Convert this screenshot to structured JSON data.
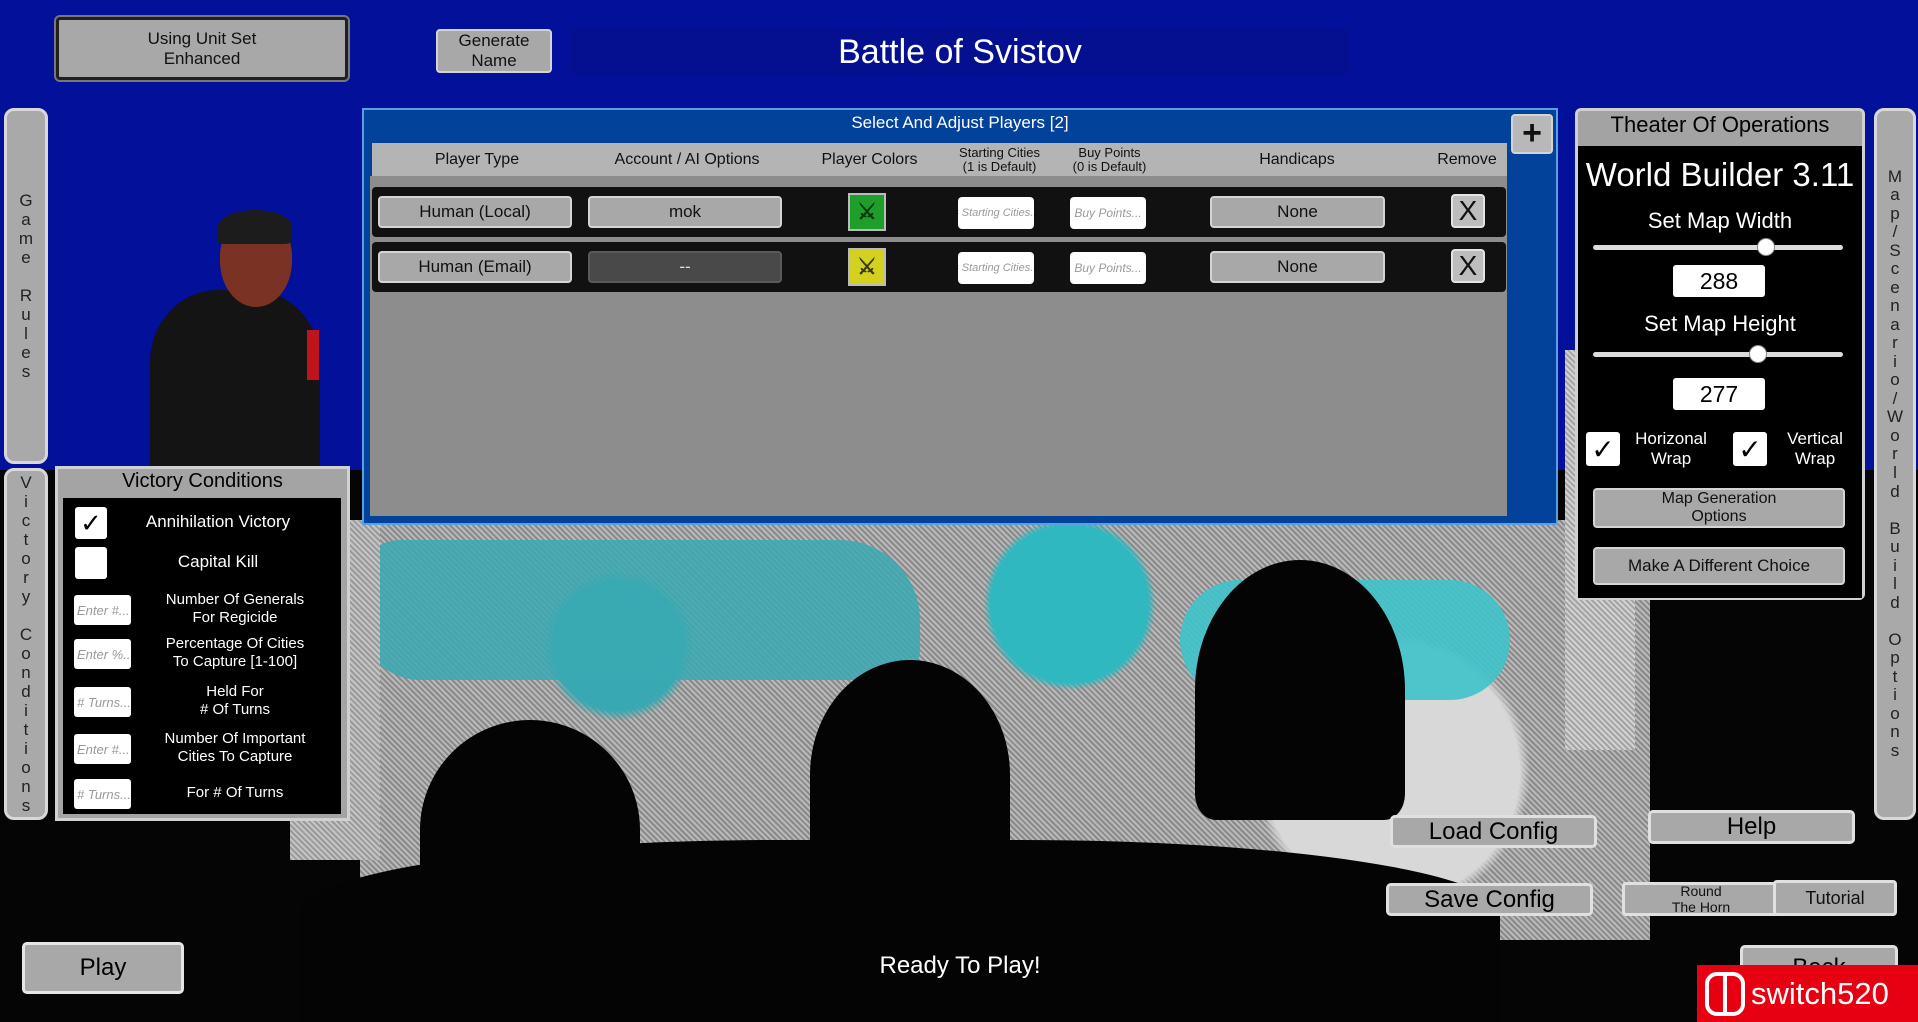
{
  "header": {
    "unit_set_label": "Using Unit Set\nEnhanced",
    "generate_name_label": "Generate\nName",
    "scenario_title": "Battle of Svistov"
  },
  "side_tabs": {
    "game_rules": [
      "G",
      "a",
      "m",
      "e",
      "",
      "R",
      "u",
      "l",
      "e",
      "s"
    ],
    "victory_conditions": [
      "V",
      "i",
      "c",
      "t",
      "o",
      "r",
      "y",
      "",
      "C",
      "o",
      "n",
      "d",
      "i",
      "t",
      "i",
      "o",
      "n",
      "s"
    ],
    "map_options": [
      "M",
      "a",
      "p",
      "/",
      "S",
      "c",
      "e",
      "n",
      "a",
      "r",
      "i",
      "o",
      "/",
      "W",
      "o",
      "r",
      "l",
      "d",
      "",
      "B",
      "u",
      "i",
      "l",
      "d",
      "",
      "O",
      "p",
      "t",
      "i",
      "o",
      "n",
      "s"
    ]
  },
  "players": {
    "title": "Select And Adjust Players [2]",
    "add_label": "+",
    "columns": {
      "player_type": "Player Type",
      "account": "Account / AI Options",
      "colors": "Player Colors",
      "starting_cities": "Starting Cities\n(1 is Default)",
      "buy_points": "Buy Points\n(0 is Default)",
      "handicaps": "Handicaps",
      "remove": "Remove"
    },
    "rows": [
      {
        "type": "Human (Local)",
        "account": "mok",
        "color": "#1e9e2a",
        "color_fg": "#0a3a0a",
        "starting_placeholder": "# Starting Cities...",
        "buy_placeholder": "Buy Points...",
        "handicap": "None",
        "remove": "X"
      },
      {
        "type": "Human (Email)",
        "account": "--",
        "color": "#d4d020",
        "color_fg": "#3a3a0a",
        "starting_placeholder": "# Starting Cities...",
        "buy_placeholder": "Buy Points...",
        "handicap": "None",
        "remove": "X"
      }
    ]
  },
  "theater": {
    "title": "Theater Of Operations",
    "builder": "World Builder 3.11",
    "width_label": "Set Map Width",
    "width_value": "288",
    "width_fraction": 0.69,
    "height_label": "Set Map Height",
    "height_value": "277",
    "height_fraction": 0.66,
    "horizontal_wrap": "Horizonal\nWrap",
    "vertical_wrap": "Vertical\nWrap",
    "map_gen_label": "Map Generation\nOptions",
    "different_choice_label": "Make A Different Choice",
    "check_mark": "✓"
  },
  "victory": {
    "title": "Victory Conditions",
    "annihilation": "Annihilation Victory",
    "capital_kill": "Capital Kill",
    "items": [
      {
        "placeholder": "Enter #...",
        "label": "Number Of Generals\nFor Regicide"
      },
      {
        "placeholder": "Enter %...",
        "label": "Percentage Of Cities\nTo Capture [1-100]"
      },
      {
        "placeholder": "# Turns...",
        "label": "Held For\n# Of Turns"
      },
      {
        "placeholder": "Enter #...",
        "label": "Number Of Important\nCities To Capture"
      },
      {
        "placeholder": "# Turns...",
        "label": "For # Of Turns"
      }
    ]
  },
  "bottom": {
    "load_config": "Load Config",
    "help": "Help",
    "save_config": "Save Config",
    "round_horn": "Round\nThe Horn",
    "tutorial": "Tutorial",
    "play": "Play",
    "status": "Ready To Play!",
    "back": "Back",
    "watermark": "switch520"
  }
}
